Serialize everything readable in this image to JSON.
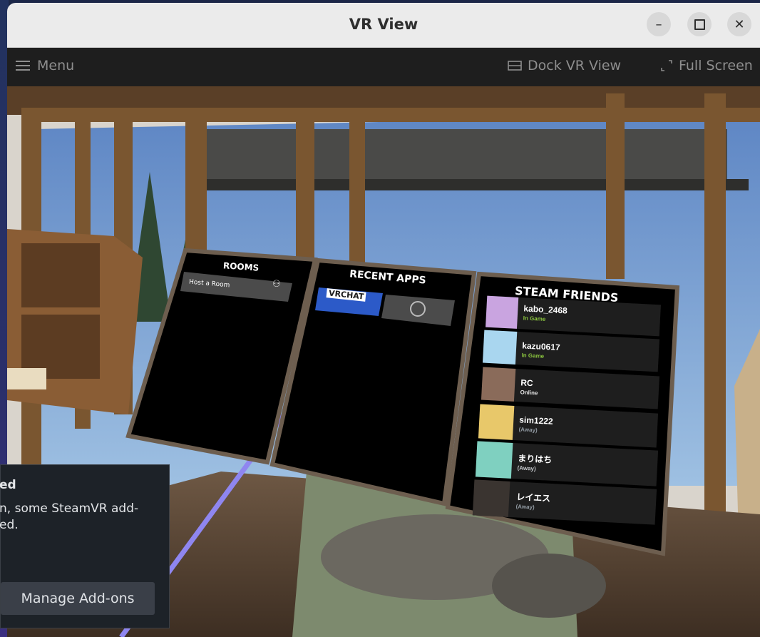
{
  "window": {
    "title": "VR View"
  },
  "toolbar": {
    "menu_label": "Menu",
    "dock_label": "Dock VR View",
    "fullscreen_label": "Full Screen"
  },
  "rooms_panel": {
    "title": "ROOMS",
    "host_label": "Host a Room"
  },
  "recent_apps_panel": {
    "title": "RECENT APPS",
    "apps": [
      {
        "name": "VRCHAT"
      },
      {
        "name": "Steam",
        "icon": "steam-icon"
      }
    ]
  },
  "friends_panel": {
    "title": "STEAM FRIENDS",
    "friends": [
      {
        "name": "kabo_2468",
        "status": "In Game",
        "status_color": "#8bc53f",
        "avatar_color": "#c9a4e0"
      },
      {
        "name": "kazu0617",
        "status": "In Game",
        "status_color": "#8bc53f",
        "avatar_color": "#a9d6ef"
      },
      {
        "name": "RC",
        "status": "Online",
        "status_color": "#e8e8e8",
        "avatar_color": "#8a6b5a"
      },
      {
        "name": "sim1222",
        "status": "(Away)",
        "status_color": "#8f98a0",
        "avatar_color": "#e8c86a"
      },
      {
        "name": "まりはち",
        "status": "(Away)",
        "status_color": "#c9ccd0",
        "avatar_color": "#7fd0c0"
      },
      {
        "name": "レイエス",
        "status": "(Away)",
        "status_color": "#8f98a0",
        "avatar_color": "#3a3430"
      }
    ]
  },
  "notification": {
    "title": "ed",
    "body_line1": "n, some SteamVR add-",
    "body_line2": "ed.",
    "button_label": "Manage Add-ons"
  },
  "colors": {
    "laser": "#8f86f0",
    "titlebar": "#ebebeb",
    "toolbar": "#1e1e1e",
    "in_game": "#8bc53f"
  }
}
